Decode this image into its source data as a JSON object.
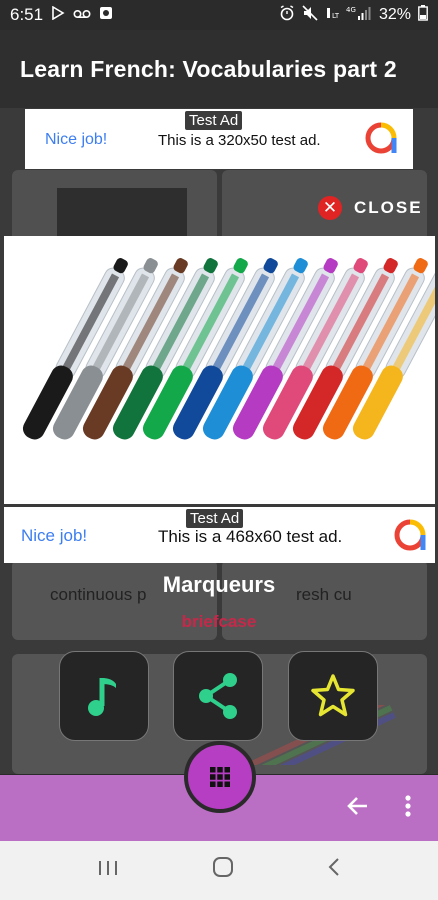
{
  "status_bar": {
    "time": "6:51",
    "battery": "32%",
    "network": "4G"
  },
  "app_bar": {
    "title": "Learn French: Vocabularies part 2"
  },
  "ad_top": {
    "label": "Test Ad",
    "nice": "Nice job!",
    "text": "This is a 320x50 test ad."
  },
  "close": {
    "label": "CLOSE"
  },
  "ad_bottom": {
    "label": "Test Ad",
    "nice": "Nice job!",
    "text": "This is a 468x60 test ad."
  },
  "word": {
    "french": "Marqueurs",
    "english": "briefcase"
  },
  "background": {
    "text_left": "continuous p",
    "text_right": "resh cu"
  },
  "actions": [
    {
      "icon": "music-note-icon",
      "color": "#2fd08c"
    },
    {
      "icon": "share-icon",
      "color": "#2fd08c"
    },
    {
      "icon": "star-icon",
      "color": "#e6e632"
    }
  ],
  "colors": {
    "bottom_bar": "#bb6fc4",
    "fab": "#b63ec3",
    "translation": "#c7284a"
  }
}
